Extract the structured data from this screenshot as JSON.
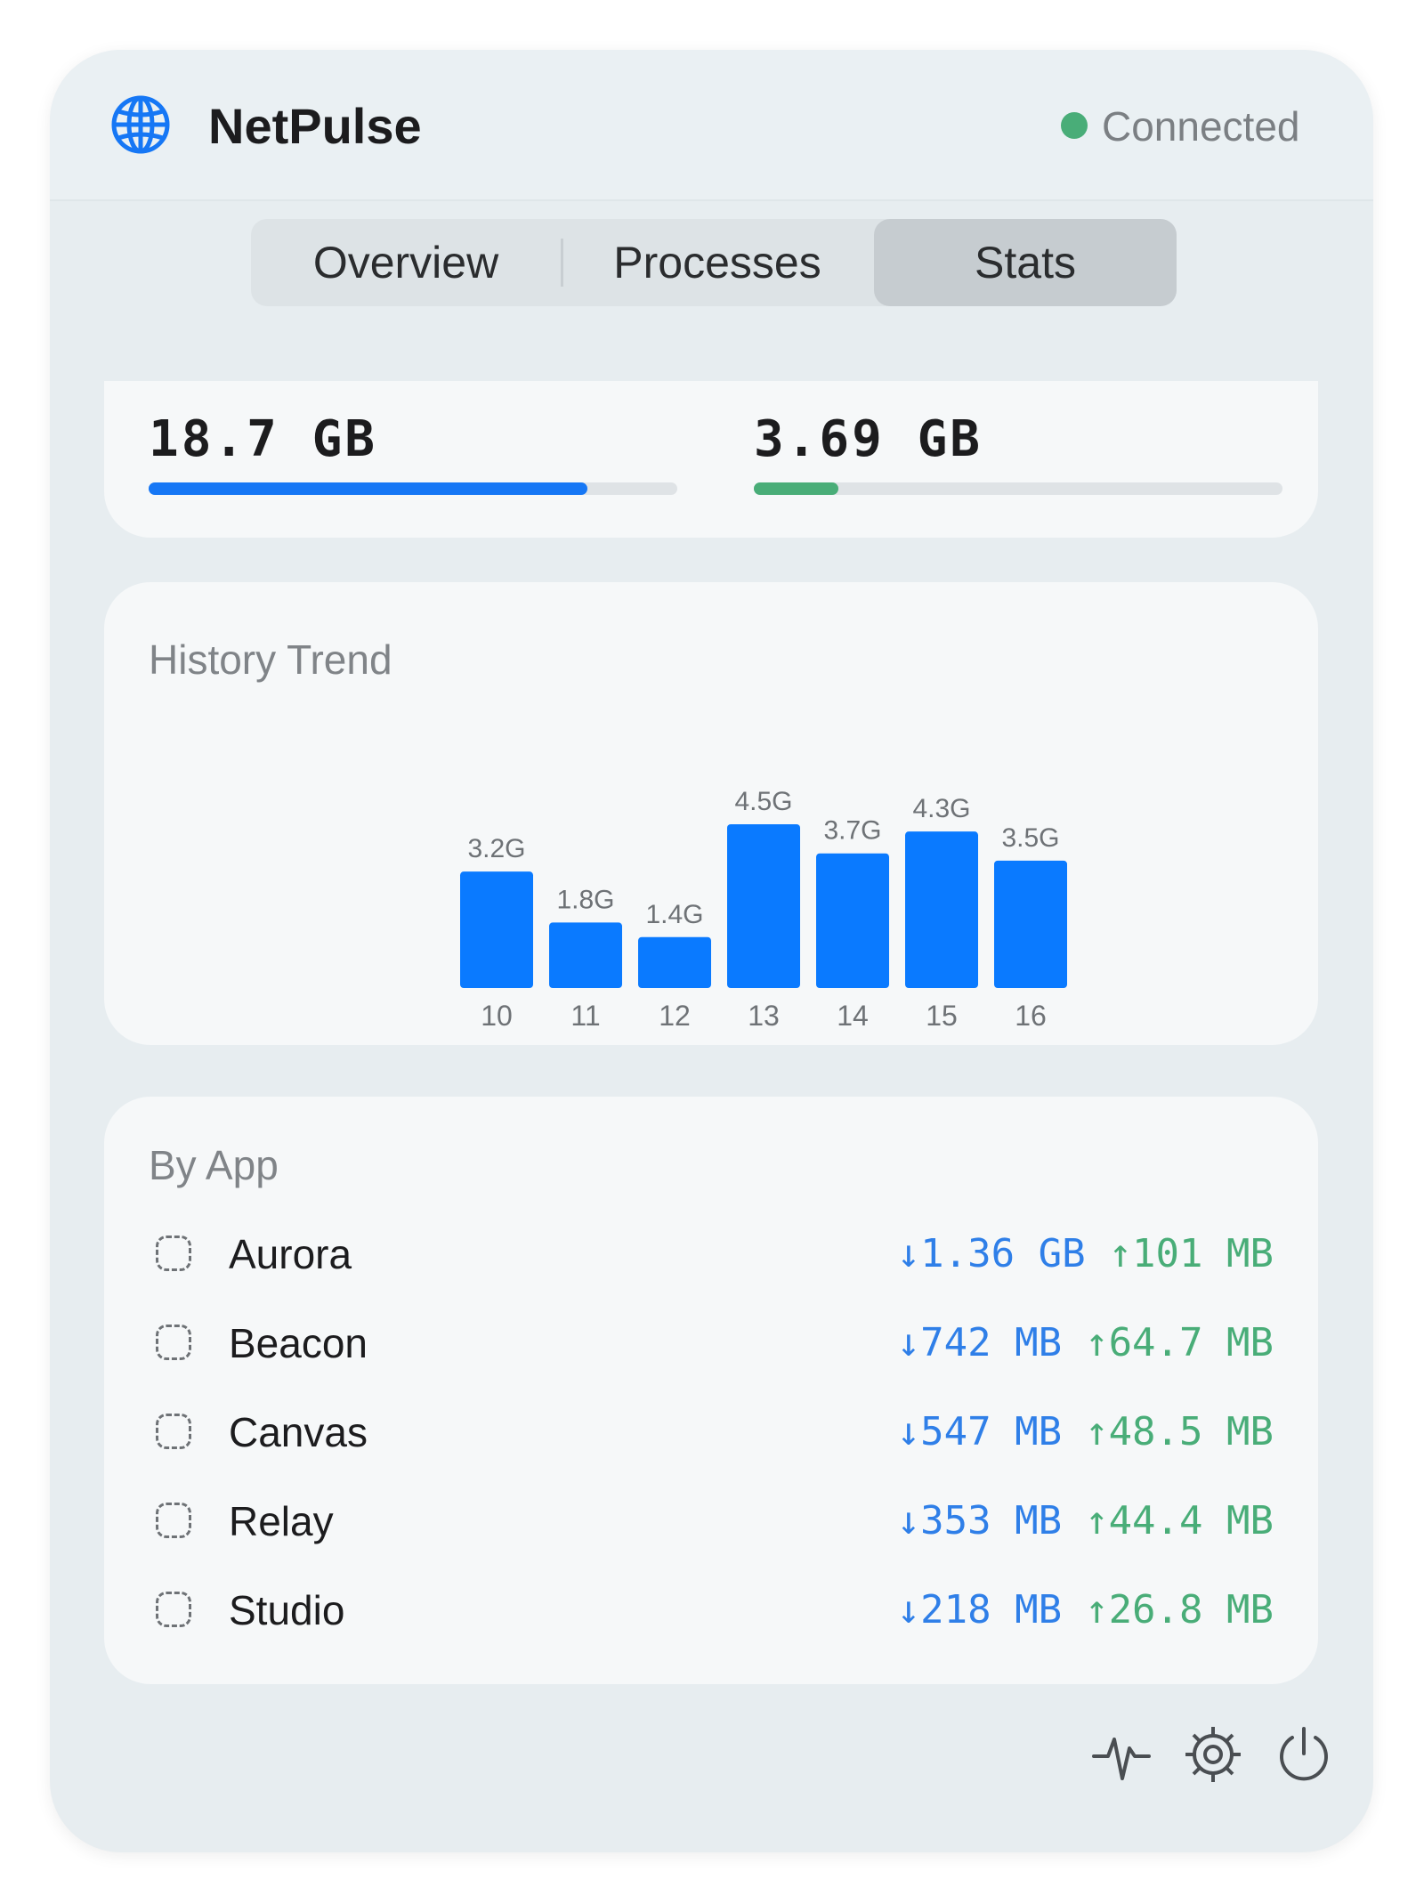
{
  "header": {
    "title": "NetPulse",
    "status": "Connected",
    "status_color": "#49ad78"
  },
  "tabs": [
    {
      "label": "Overview",
      "active": false
    },
    {
      "label": "Processes",
      "active": false
    },
    {
      "label": "Stats",
      "active": true
    }
  ],
  "totals": [
    {
      "value": "18.7 GB",
      "fraction": 0.83,
      "color": "#1677f5"
    },
    {
      "value": "3.69 GB",
      "fraction": 0.16,
      "color": "#49ad78"
    }
  ],
  "trend": {
    "title": "History Trend",
    "chart_data": {
      "type": "bar",
      "categories": [
        "10",
        "11",
        "12",
        "13",
        "14",
        "15",
        "16"
      ],
      "values": [
        3.2,
        1.8,
        1.4,
        4.5,
        3.7,
        4.3,
        3.5
      ],
      "labels": [
        "3.2G",
        "1.8G",
        "1.4G",
        "4.5G",
        "3.7G",
        "4.3G",
        "3.5G"
      ],
      "ylim": [
        0,
        4.5
      ],
      "color": "#0a7aff"
    }
  },
  "by_app": {
    "title": "By App",
    "rows": [
      {
        "name": "Aurora",
        "down": "↓1.36 GB",
        "up": "↑101 MB"
      },
      {
        "name": "Beacon",
        "down": "↓742 MB",
        "up": "↑64.7 MB"
      },
      {
        "name": "Canvas",
        "down": "↓547 MB",
        "up": "↑48.5 MB"
      },
      {
        "name": "Relay",
        "down": "↓353 MB",
        "up": "↑44.4 MB"
      },
      {
        "name": "Studio",
        "down": "↓218 MB",
        "up": "↑26.8 MB"
      }
    ]
  },
  "footer": {
    "icons": [
      "activity-icon",
      "gear-icon",
      "power-icon"
    ]
  }
}
